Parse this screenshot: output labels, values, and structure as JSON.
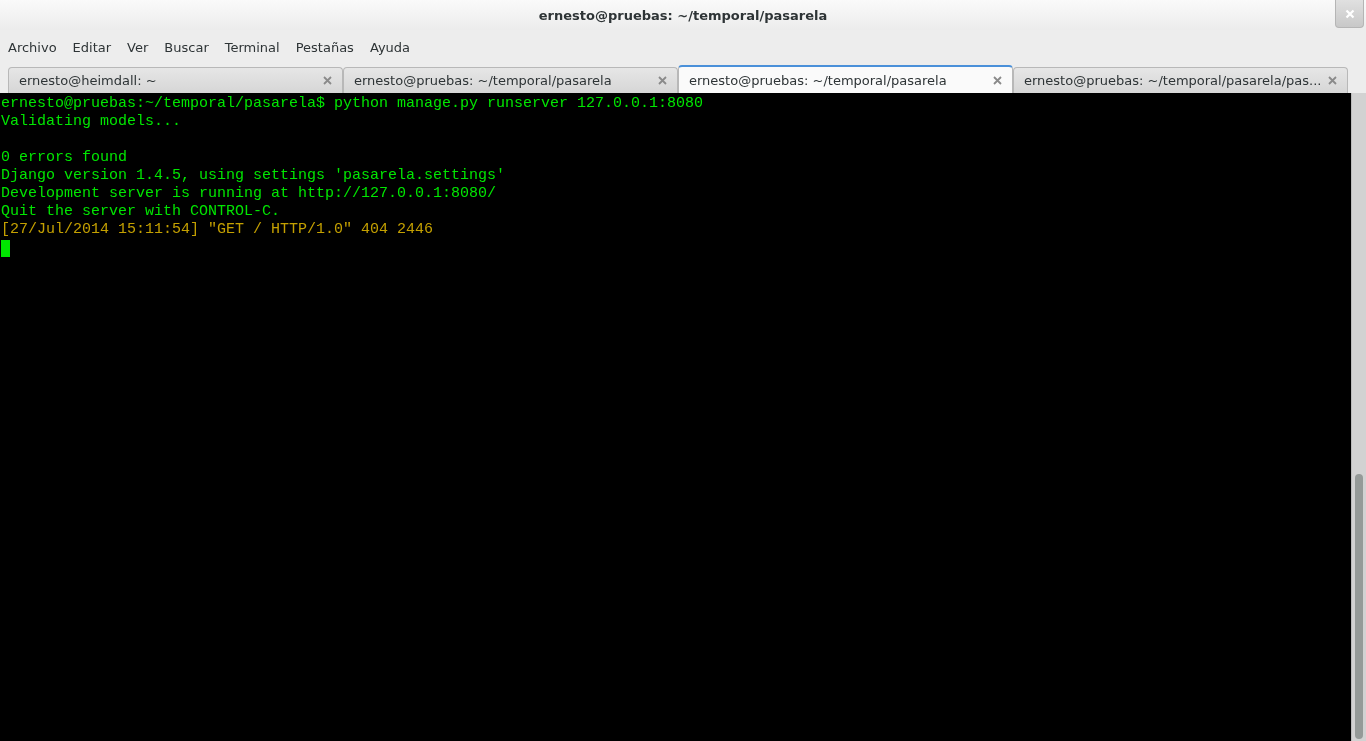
{
  "window": {
    "title": "ernesto@pruebas: ~/temporal/pasarela"
  },
  "menu": [
    "Archivo",
    "Editar",
    "Ver",
    "Buscar",
    "Terminal",
    "Pestañas",
    "Ayuda"
  ],
  "tabs": [
    {
      "label": "ernesto@heimdall: ~",
      "selected": false
    },
    {
      "label": "ernesto@pruebas: ~/temporal/pasarela",
      "selected": false
    },
    {
      "label": "ernesto@pruebas: ~/temporal/pasarela",
      "selected": true
    },
    {
      "label": "ernesto@pruebas: ~/temporal/pasarela/pas...",
      "selected": false
    }
  ],
  "terminal": {
    "lines": [
      {
        "kind": "text",
        "text": "ernesto@pruebas:~/temporal/pasarela$ python manage.py runserver 127.0.0.1:8080",
        "color": "#00e600"
      },
      {
        "kind": "text",
        "text": "Validating models...",
        "color": "#00e600"
      },
      {
        "kind": "blank"
      },
      {
        "kind": "text",
        "text": "0 errors found",
        "color": "#00e600"
      },
      {
        "kind": "text",
        "text": "Django version 1.4.5, using settings 'pasarela.settings'",
        "color": "#00e600"
      },
      {
        "kind": "text",
        "text": "Development server is running at http://127.0.0.1:8080/",
        "color": "#00e600"
      },
      {
        "kind": "text",
        "text": "Quit the server with CONTROL-C.",
        "color": "#00e600"
      },
      {
        "kind": "text",
        "text": "[27/Jul/2014 15:11:54] \"GET / HTTP/1.0\" 404 2446",
        "color": "#c4a000"
      },
      {
        "kind": "cursor"
      }
    ]
  }
}
